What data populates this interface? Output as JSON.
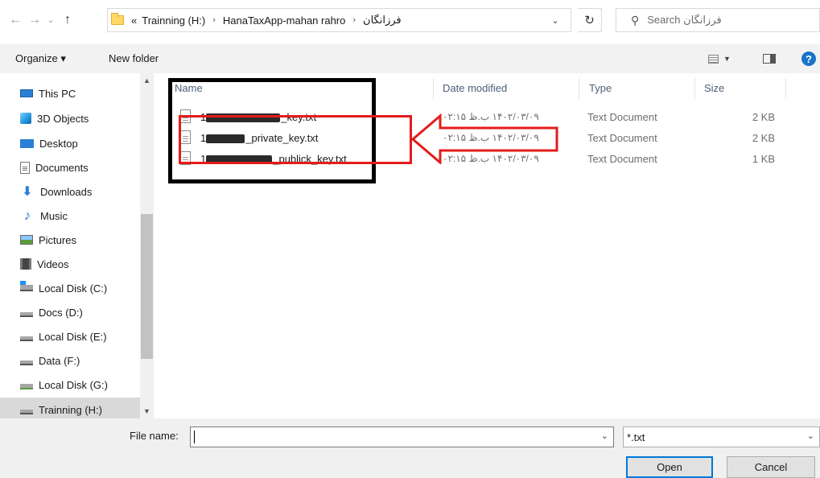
{
  "address": {
    "crumbs": [
      "Trainning (H:)",
      "HanaTaxApp-mahan rahro",
      "فرزانگان"
    ],
    "overflow": "«"
  },
  "search": {
    "placeholder": "Search فرزانگان"
  },
  "toolbar": {
    "organize": "Organize ▾",
    "new_folder": "New folder",
    "help": "?"
  },
  "nav": {
    "items": [
      {
        "label": "This PC",
        "icon": "computer-icon"
      },
      {
        "label": "3D Objects",
        "icon": "3d-objects-icon"
      },
      {
        "label": "Desktop",
        "icon": "desktop-icon"
      },
      {
        "label": "Documents",
        "icon": "documents-icon"
      },
      {
        "label": "Downloads",
        "icon": "downloads-icon"
      },
      {
        "label": "Music",
        "icon": "music-icon"
      },
      {
        "label": "Pictures",
        "icon": "pictures-icon"
      },
      {
        "label": "Videos",
        "icon": "videos-icon"
      },
      {
        "label": "Local Disk (C:)",
        "icon": "drive-c-icon"
      },
      {
        "label": "Docs (D:)",
        "icon": "drive-icon"
      },
      {
        "label": "Local Disk (E:)",
        "icon": "drive-icon"
      },
      {
        "label": "Data (F:)",
        "icon": "drive-icon"
      },
      {
        "label": "Local Disk (G:)",
        "icon": "network-drive-icon"
      },
      {
        "label": "Trainning (H:)",
        "icon": "drive-icon"
      }
    ],
    "selected": "Trainning (H:)"
  },
  "columns": {
    "name": "Name",
    "date": "Date modified",
    "type": "Type",
    "size": "Size"
  },
  "files": [
    {
      "prefix": "1",
      "suffix": "_key.txt",
      "date": "۱۴۰۲/۰۳/۰۹ ب.ظ ۰۲:۱۵",
      "type": "Text Document",
      "size": "2 KB"
    },
    {
      "prefix": "1",
      "suffix": "_private_key.txt",
      "date": "۱۴۰۲/۰۳/۰۹ ب.ظ ۰۲:۱۵",
      "type": "Text Document",
      "size": "2 KB"
    },
    {
      "prefix": "1",
      "suffix": "_publick_key.txt",
      "date": "۱۴۰۲/۰۳/۰۹ ب.ظ ۰۲:۱۵",
      "type": "Text Document",
      "size": "1 KB"
    }
  ],
  "bottom": {
    "file_name_label": "File name:",
    "file_name_value": "",
    "filter": "*.txt",
    "open": "Open",
    "cancel": "Cancel"
  },
  "colors": {
    "annotation_red": "#e51b1b",
    "annotation_black": "#000000",
    "accent": "#0078d7"
  }
}
